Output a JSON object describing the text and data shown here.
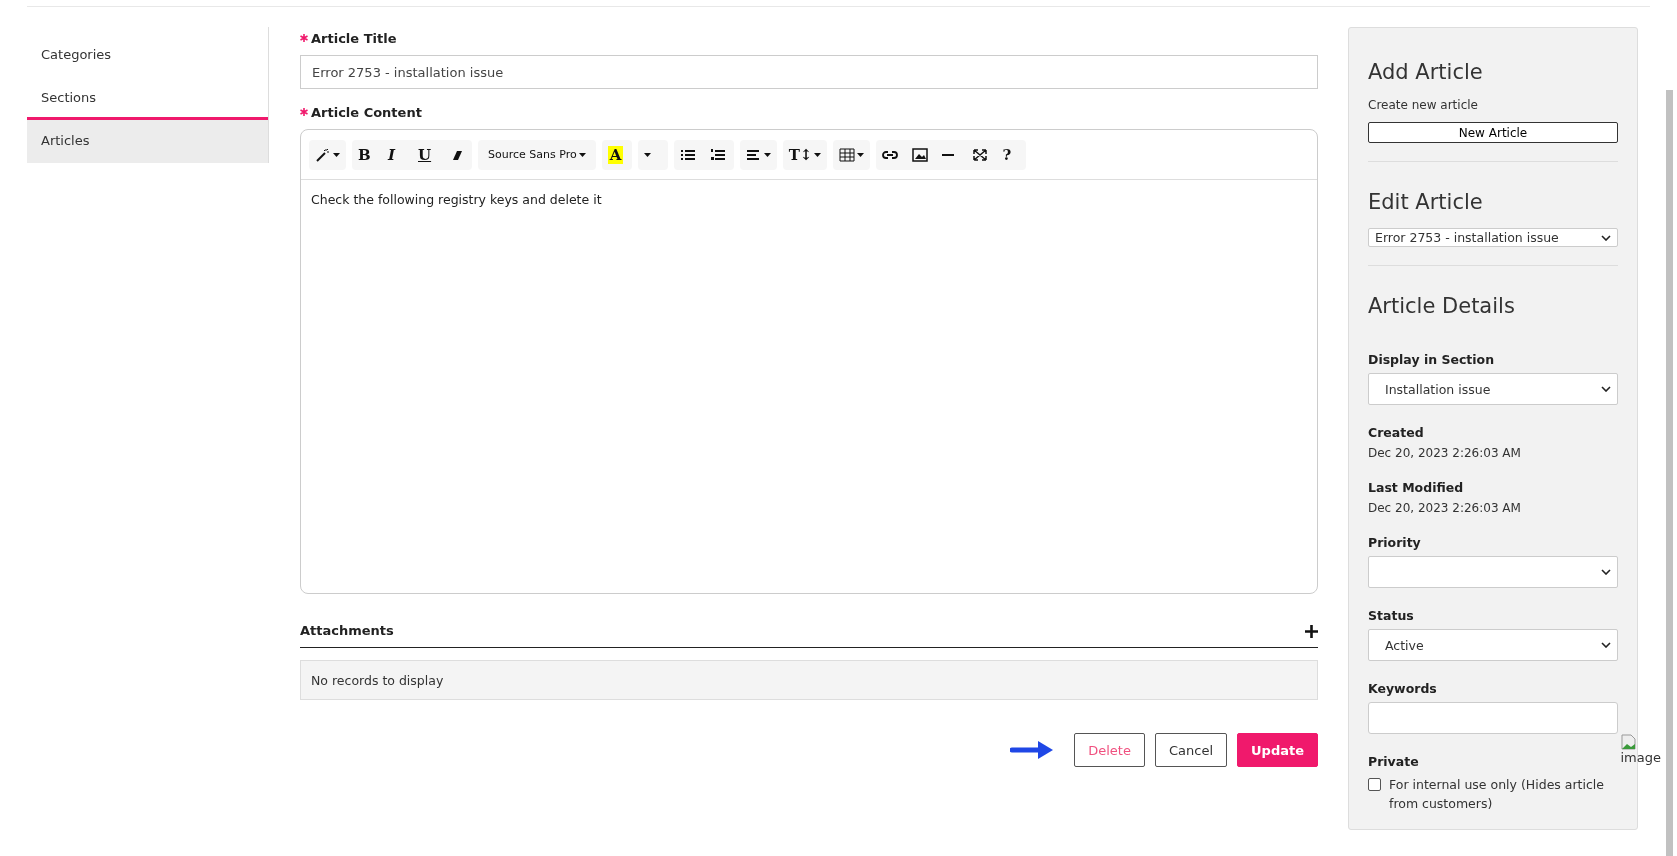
{
  "sidebar": {
    "items": [
      {
        "label": "Categories",
        "selected": false,
        "underlined": false
      },
      {
        "label": "Sections",
        "selected": false,
        "underlined": true
      },
      {
        "label": "Articles",
        "selected": true,
        "underlined": false
      }
    ]
  },
  "form": {
    "title_label": "Article Title",
    "title_value": "Error 2753 - installation issue",
    "content_label": "Article Content",
    "toolbar": [
      {
        "items": [
          {
            "kind": "magic",
            "caret": true
          }
        ]
      },
      {
        "items": [
          {
            "kind": "bold",
            "label": "B",
            "caret": false
          },
          {
            "kind": "italic",
            "label": "I",
            "caret": false
          },
          {
            "kind": "underline",
            "label": "U",
            "caret": false
          },
          {
            "kind": "eraser",
            "caret": false
          }
        ]
      },
      {
        "items": [
          {
            "kind": "font",
            "label": "Source Sans Pro",
            "caret": true
          }
        ]
      },
      {
        "items": [
          {
            "kind": "highlight",
            "label": "A",
            "caret": false
          }
        ]
      },
      {
        "items": [
          {
            "kind": "dropdown",
            "caret": true
          }
        ]
      },
      {
        "items": [
          {
            "kind": "ul",
            "caret": false
          },
          {
            "kind": "ol",
            "caret": false
          }
        ]
      },
      {
        "items": [
          {
            "kind": "align",
            "caret": true
          }
        ]
      },
      {
        "items": [
          {
            "kind": "bold",
            "label": "T↕",
            "caret": true
          }
        ]
      },
      {
        "items": [
          {
            "kind": "table",
            "caret": true
          }
        ]
      },
      {
        "items": [
          {
            "kind": "link",
            "caret": false
          },
          {
            "kind": "picture",
            "caret": false
          },
          {
            "kind": "rule",
            "caret": false
          },
          {
            "kind": "fullscreen",
            "caret": false
          },
          {
            "kind": "bold",
            "label": "?",
            "caret": false
          }
        ]
      }
    ],
    "content": "Check the following registry keys and delete it",
    "attachments_label": "Attachments",
    "attachments_empty": "No records to display",
    "buttons": [
      {
        "label": "Delete",
        "kind": "danger"
      },
      {
        "label": "Cancel",
        "kind": "plain"
      },
      {
        "label": "Update",
        "kind": "primary"
      }
    ]
  },
  "panel": {
    "add_title": "Add Article",
    "add_hint": "Create new article",
    "new_button": "New Article",
    "edit_title": "Edit Article",
    "edit_value": "Error 2753 - installation issue",
    "details_title": "Article Details",
    "fields": [
      {
        "kind": "select",
        "label": "Display in Section",
        "value": "Installation issue"
      },
      {
        "kind": "info",
        "label": "Created",
        "value": "Dec 20, 2023 2:26:03 AM"
      },
      {
        "kind": "info",
        "label": "Last Modified",
        "value": "Dec 20, 2023 2:26:03 AM"
      },
      {
        "kind": "select",
        "label": "Priority"
      },
      {
        "kind": "select",
        "label": "Status",
        "value": "Active"
      },
      {
        "kind": "input",
        "label": "Keywords"
      },
      {
        "kind": "checkbox",
        "label": "Private",
        "value": "For internal use only (Hides article from customers)",
        "checked": false
      }
    ],
    "broken_image_alt": "image"
  }
}
